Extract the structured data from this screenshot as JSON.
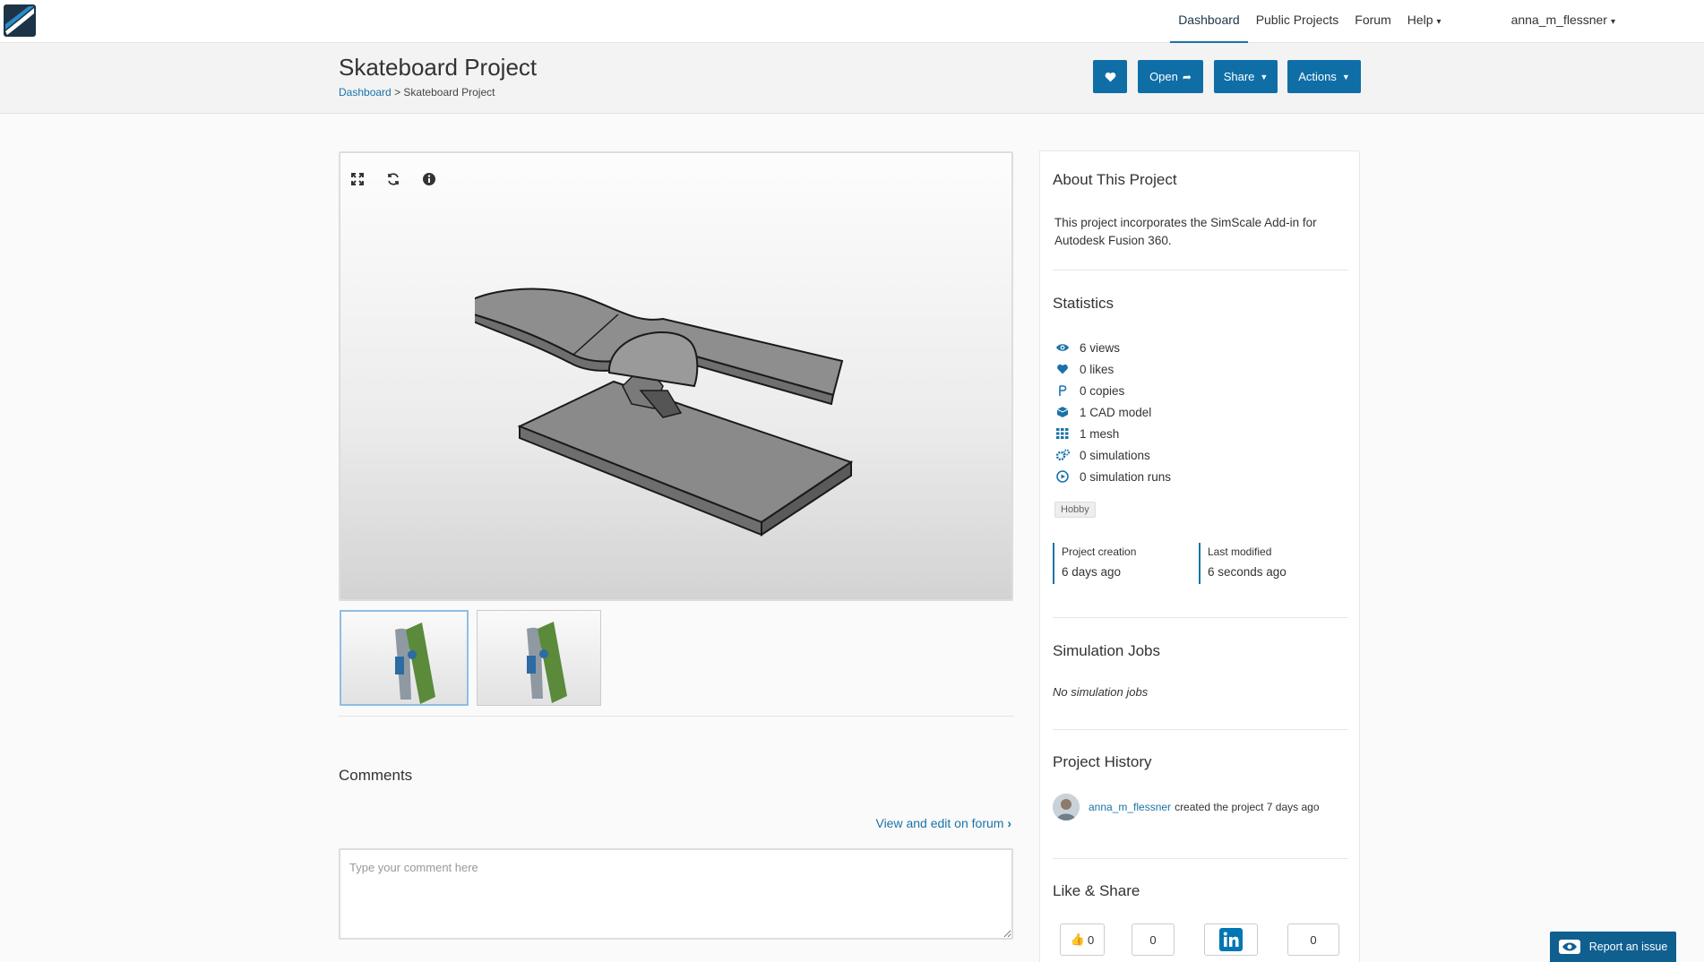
{
  "nav": {
    "links": [
      "Dashboard",
      "Public Projects",
      "Forum",
      "Help"
    ],
    "active": "Dashboard",
    "user": "anna_m_flessner"
  },
  "header": {
    "title": "Skateboard Project",
    "breadcrumb_root": "Dashboard",
    "breadcrumb_sep": ">",
    "breadcrumb_current": "Skateboard Project",
    "buttons": {
      "open": "Open",
      "share": "Share",
      "actions": "Actions"
    }
  },
  "comments": {
    "title": "Comments",
    "forum_link": "View and edit on forum",
    "placeholder": "Type your comment here"
  },
  "about": {
    "title": "About This Project",
    "text": "This project incorporates the SimScale Add-in for Autodesk Fusion 360."
  },
  "statistics": {
    "title": "Statistics",
    "items": [
      {
        "icon": "eye-icon",
        "label": "6 views"
      },
      {
        "icon": "heart-icon",
        "label": "0 likes"
      },
      {
        "icon": "copy-icon",
        "label": "0 copies"
      },
      {
        "icon": "cube-icon",
        "label": "1 CAD model"
      },
      {
        "icon": "grid-icon",
        "label": "1 mesh"
      },
      {
        "icon": "gears-icon",
        "label": "0 simulations"
      },
      {
        "icon": "play-circle-icon",
        "label": "0 simulation runs"
      }
    ],
    "tag": "Hobby",
    "created_label": "Project creation",
    "created_value": "6 days ago",
    "modified_label": "Last modified",
    "modified_value": "6 seconds ago"
  },
  "jobs": {
    "title": "Simulation Jobs",
    "empty": "No simulation jobs"
  },
  "history": {
    "title": "Project History",
    "user": "anna_m_flessner",
    "text": "created the project 7 days ago"
  },
  "like_share": {
    "title": "Like & Share",
    "like_count": "0",
    "count2": "0",
    "count3": "0"
  },
  "report": "Report an issue",
  "colors": {
    "primary": "#0f6ea6",
    "link": "#1a73a8"
  }
}
